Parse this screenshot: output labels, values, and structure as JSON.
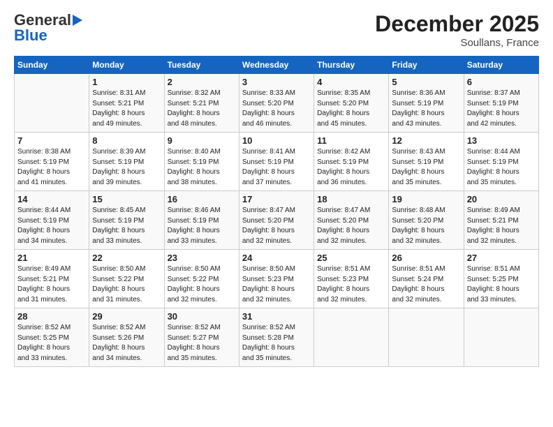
{
  "header": {
    "logo_line1": "General",
    "logo_line2": "Blue",
    "month": "December 2025",
    "location": "Soullans, France"
  },
  "weekdays": [
    "Sunday",
    "Monday",
    "Tuesday",
    "Wednesday",
    "Thursday",
    "Friday",
    "Saturday"
  ],
  "weeks": [
    [
      {
        "day": "",
        "info": ""
      },
      {
        "day": "1",
        "info": "Sunrise: 8:31 AM\nSunset: 5:21 PM\nDaylight: 8 hours\nand 49 minutes."
      },
      {
        "day": "2",
        "info": "Sunrise: 8:32 AM\nSunset: 5:21 PM\nDaylight: 8 hours\nand 48 minutes."
      },
      {
        "day": "3",
        "info": "Sunrise: 8:33 AM\nSunset: 5:20 PM\nDaylight: 8 hours\nand 46 minutes."
      },
      {
        "day": "4",
        "info": "Sunrise: 8:35 AM\nSunset: 5:20 PM\nDaylight: 8 hours\nand 45 minutes."
      },
      {
        "day": "5",
        "info": "Sunrise: 8:36 AM\nSunset: 5:19 PM\nDaylight: 8 hours\nand 43 minutes."
      },
      {
        "day": "6",
        "info": "Sunrise: 8:37 AM\nSunset: 5:19 PM\nDaylight: 8 hours\nand 42 minutes."
      }
    ],
    [
      {
        "day": "7",
        "info": "Sunrise: 8:38 AM\nSunset: 5:19 PM\nDaylight: 8 hours\nand 41 minutes."
      },
      {
        "day": "8",
        "info": "Sunrise: 8:39 AM\nSunset: 5:19 PM\nDaylight: 8 hours\nand 39 minutes."
      },
      {
        "day": "9",
        "info": "Sunrise: 8:40 AM\nSunset: 5:19 PM\nDaylight: 8 hours\nand 38 minutes."
      },
      {
        "day": "10",
        "info": "Sunrise: 8:41 AM\nSunset: 5:19 PM\nDaylight: 8 hours\nand 37 minutes."
      },
      {
        "day": "11",
        "info": "Sunrise: 8:42 AM\nSunset: 5:19 PM\nDaylight: 8 hours\nand 36 minutes."
      },
      {
        "day": "12",
        "info": "Sunrise: 8:43 AM\nSunset: 5:19 PM\nDaylight: 8 hours\nand 35 minutes."
      },
      {
        "day": "13",
        "info": "Sunrise: 8:44 AM\nSunset: 5:19 PM\nDaylight: 8 hours\nand 35 minutes."
      }
    ],
    [
      {
        "day": "14",
        "info": "Sunrise: 8:44 AM\nSunset: 5:19 PM\nDaylight: 8 hours\nand 34 minutes."
      },
      {
        "day": "15",
        "info": "Sunrise: 8:45 AM\nSunset: 5:19 PM\nDaylight: 8 hours\nand 33 minutes."
      },
      {
        "day": "16",
        "info": "Sunrise: 8:46 AM\nSunset: 5:19 PM\nDaylight: 8 hours\nand 33 minutes."
      },
      {
        "day": "17",
        "info": "Sunrise: 8:47 AM\nSunset: 5:20 PM\nDaylight: 8 hours\nand 32 minutes."
      },
      {
        "day": "18",
        "info": "Sunrise: 8:47 AM\nSunset: 5:20 PM\nDaylight: 8 hours\nand 32 minutes."
      },
      {
        "day": "19",
        "info": "Sunrise: 8:48 AM\nSunset: 5:20 PM\nDaylight: 8 hours\nand 32 minutes."
      },
      {
        "day": "20",
        "info": "Sunrise: 8:49 AM\nSunset: 5:21 PM\nDaylight: 8 hours\nand 32 minutes."
      }
    ],
    [
      {
        "day": "21",
        "info": "Sunrise: 8:49 AM\nSunset: 5:21 PM\nDaylight: 8 hours\nand 31 minutes."
      },
      {
        "day": "22",
        "info": "Sunrise: 8:50 AM\nSunset: 5:22 PM\nDaylight: 8 hours\nand 31 minutes."
      },
      {
        "day": "23",
        "info": "Sunrise: 8:50 AM\nSunset: 5:22 PM\nDaylight: 8 hours\nand 32 minutes."
      },
      {
        "day": "24",
        "info": "Sunrise: 8:50 AM\nSunset: 5:23 PM\nDaylight: 8 hours\nand 32 minutes."
      },
      {
        "day": "25",
        "info": "Sunrise: 8:51 AM\nSunset: 5:23 PM\nDaylight: 8 hours\nand 32 minutes."
      },
      {
        "day": "26",
        "info": "Sunrise: 8:51 AM\nSunset: 5:24 PM\nDaylight: 8 hours\nand 32 minutes."
      },
      {
        "day": "27",
        "info": "Sunrise: 8:51 AM\nSunset: 5:25 PM\nDaylight: 8 hours\nand 33 minutes."
      }
    ],
    [
      {
        "day": "28",
        "info": "Sunrise: 8:52 AM\nSunset: 5:25 PM\nDaylight: 8 hours\nand 33 minutes."
      },
      {
        "day": "29",
        "info": "Sunrise: 8:52 AM\nSunset: 5:26 PM\nDaylight: 8 hours\nand 34 minutes."
      },
      {
        "day": "30",
        "info": "Sunrise: 8:52 AM\nSunset: 5:27 PM\nDaylight: 8 hours\nand 35 minutes."
      },
      {
        "day": "31",
        "info": "Sunrise: 8:52 AM\nSunset: 5:28 PM\nDaylight: 8 hours\nand 35 minutes."
      },
      {
        "day": "",
        "info": ""
      },
      {
        "day": "",
        "info": ""
      },
      {
        "day": "",
        "info": ""
      }
    ]
  ]
}
